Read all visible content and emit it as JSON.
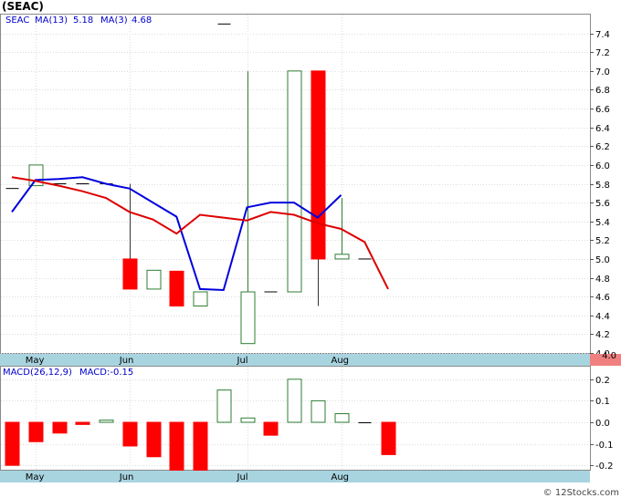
{
  "title": "(SEAC)",
  "footer": "© 12Stocks.com",
  "legend": {
    "symbol": "SEAC",
    "ma13_label": "MA(13)",
    "ma13_value": "5.18",
    "ma3_label": "MA(3)",
    "ma3_value": "4.68"
  },
  "macd_legend": {
    "label": "MACD(26,12,9)",
    "value_label": "MACD:-0.15"
  },
  "colors": {
    "up_candle": "#2e7d32",
    "down_candle": "#ff0000",
    "ma13_line": "#0000dd",
    "ma3_line": "#dd0000",
    "axis_band": "#a8d4e0",
    "last_price_badge": "#f08080",
    "legend_text": "#0000cc"
  },
  "chart_data": [
    {
      "type": "candlestick",
      "ylim": [
        4.0,
        7.6
      ],
      "y_ticks": [
        "4.0",
        "4.2",
        "4.4",
        "4.6",
        "4.8",
        "5.0",
        "5.2",
        "5.4",
        "5.6",
        "5.8",
        "6.0",
        "6.2",
        "6.4",
        "6.6",
        "6.8",
        "7.0",
        "7.2",
        "7.4"
      ],
      "last_price": "4.0",
      "x_labels": [
        "May",
        "Jun",
        "Jul",
        "Aug"
      ],
      "x_label_index": [
        1,
        5,
        10,
        14
      ],
      "candles": [
        {
          "o": 5.75,
          "h": 5.75,
          "l": 5.75,
          "c": 5.75
        },
        {
          "o": 5.78,
          "h": 6.0,
          "l": 5.78,
          "c": 6.0
        },
        {
          "o": 5.8,
          "h": 5.8,
          "l": 5.8,
          "c": 5.8
        },
        {
          "o": 5.8,
          "h": 5.8,
          "l": 5.8,
          "c": 5.8
        },
        {
          "o": 5.8,
          "h": 5.8,
          "l": 5.8,
          "c": 5.8
        },
        {
          "o": 5.0,
          "h": 5.8,
          "l": 4.68,
          "c": 4.68
        },
        {
          "o": 4.68,
          "h": 4.88,
          "l": 4.68,
          "c": 4.88
        },
        {
          "o": 4.87,
          "h": 4.87,
          "l": 4.5,
          "c": 4.5
        },
        {
          "o": 4.5,
          "h": 4.65,
          "l": 4.5,
          "c": 4.65
        },
        {
          "o": 7.5,
          "h": 7.5,
          "l": 7.5,
          "c": 7.5
        },
        {
          "o": 4.1,
          "h": 7.0,
          "l": 4.1,
          "c": 4.65
        },
        {
          "o": 4.65,
          "h": 4.65,
          "l": 4.65,
          "c": 4.65
        },
        {
          "o": 4.65,
          "h": 7.0,
          "l": 4.65,
          "c": 7.0
        },
        {
          "o": 7.0,
          "h": 7.0,
          "l": 4.5,
          "c": 5.0
        },
        {
          "o": 5.0,
          "h": 5.65,
          "l": 5.0,
          "c": 5.05
        },
        {
          "o": 5.0,
          "h": 5.0,
          "l": 5.0,
          "c": 5.0
        }
      ],
      "series": [
        {
          "name": "MA(13)",
          "x": [
            0,
            1,
            2,
            3,
            4,
            5,
            6,
            7,
            8,
            9,
            10,
            11,
            12,
            13,
            14
          ],
          "values": [
            5.5,
            5.84,
            5.85,
            5.87,
            5.8,
            5.75,
            5.6,
            5.45,
            4.68,
            4.67,
            5.55,
            5.6,
            5.6,
            5.44,
            5.68
          ]
        },
        {
          "name": "MA(3)",
          "x": [
            0,
            1,
            2,
            3,
            4,
            5,
            6,
            7,
            8,
            9,
            10,
            11,
            12,
            13,
            14,
            15,
            16
          ],
          "values": [
            5.87,
            5.83,
            5.78,
            5.72,
            5.65,
            5.5,
            5.42,
            5.27,
            5.47,
            5.44,
            5.41,
            5.5,
            5.47,
            5.38,
            5.32,
            5.18,
            4.68
          ]
        }
      ]
    },
    {
      "type": "bar",
      "ylim": [
        -0.23,
        0.23
      ],
      "y_ticks": [
        "0.2",
        "0.1",
        "0.0",
        "-0.1",
        "-0.2"
      ],
      "x_labels": [
        "May",
        "Jun",
        "Jul",
        "Aug"
      ],
      "x_label_index": [
        1,
        5,
        10,
        14
      ],
      "values": [
        -0.2,
        -0.09,
        -0.05,
        -0.01,
        0.01,
        -0.11,
        -0.16,
        -0.23,
        -0.23,
        0.15,
        0.02,
        -0.06,
        0.2,
        0.1,
        0.04,
        0.0,
        -0.15
      ]
    }
  ]
}
